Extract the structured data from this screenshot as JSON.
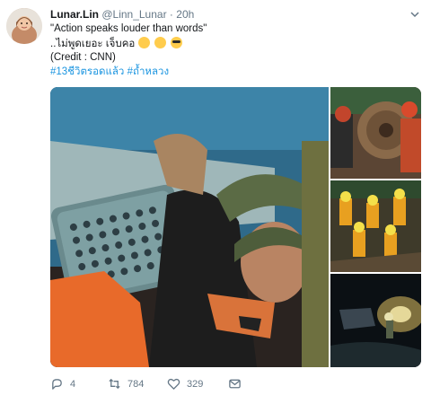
{
  "author": {
    "name": "Lunar.Lin",
    "handle": "@Linn_Lunar",
    "separator": "·",
    "time": "20h"
  },
  "tweet": {
    "line1": "\"Action speaks louder than words\"",
    "line2_text": "..ไม่พูดเยอะ เจ็บคอ",
    "line3": "(Credit : CNN)",
    "hashtag1": "#13ชีวิตรอดแล้ว",
    "hashtag2": "#ถ้ำหลวง"
  },
  "icons": {
    "avatar": "avatar-photo",
    "menu": "chevron-down-icon",
    "reply": "reply-icon",
    "retweet": "retweet-icon",
    "like": "heart-icon",
    "dm": "envelope-icon",
    "emojis": [
      "zipper-mouth-face-emoji",
      "relieved-face-emoji",
      "sunglasses-face-emoji"
    ]
  },
  "stats": {
    "replies": "4",
    "retweets": "784",
    "likes": "329"
  },
  "colors": {
    "link": "#1b95e0",
    "muted": "#657786",
    "text": "#14171a"
  }
}
